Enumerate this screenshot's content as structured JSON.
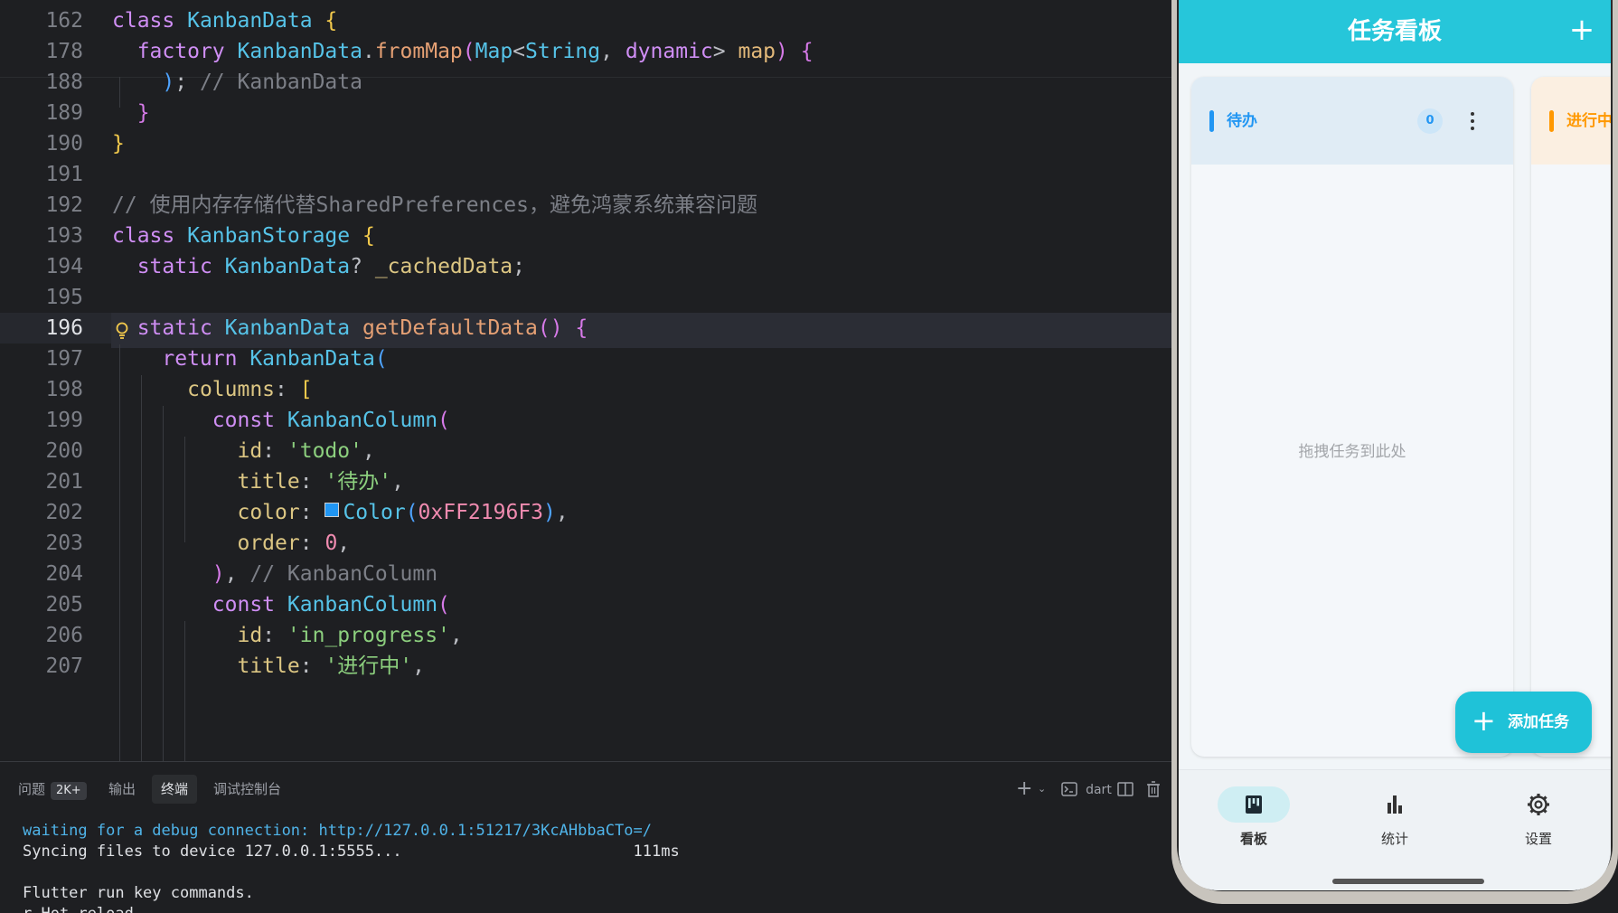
{
  "editor": {
    "lines": [
      {
        "n": "162",
        "tokens": [
          [
            "kw",
            "class "
          ],
          [
            "cls",
            "KanbanData "
          ],
          [
            "br1",
            "{"
          ]
        ]
      },
      {
        "n": "178",
        "tokens": [
          [
            "pl",
            "  "
          ],
          [
            "kw",
            "factory "
          ],
          [
            "cls",
            "KanbanData"
          ],
          [
            "pl",
            "."
          ],
          [
            "fn",
            "fromMap"
          ],
          [
            "br2",
            "("
          ],
          [
            "cls",
            "Map"
          ],
          [
            "pl",
            "<"
          ],
          [
            "cls",
            "String"
          ],
          [
            "pl",
            ", "
          ],
          [
            "kw",
            "dynamic"
          ],
          [
            "pl",
            "> "
          ],
          [
            "prm",
            "map"
          ],
          [
            "br2",
            ") "
          ],
          [
            "br2",
            "{"
          ]
        ]
      },
      {
        "n": "188",
        "tokens": [
          [
            "pl",
            "    "
          ],
          [
            "br3",
            ")"
          ],
          [
            "pl",
            "; "
          ],
          [
            "cmt",
            "// KanbanData"
          ]
        ]
      },
      {
        "n": "189",
        "tokens": [
          [
            "pl",
            "  "
          ],
          [
            "br2",
            "}"
          ]
        ]
      },
      {
        "n": "190",
        "tokens": [
          [
            "br1",
            "}"
          ]
        ]
      },
      {
        "n": "191",
        "tokens": []
      },
      {
        "n": "192",
        "tokens": [
          [
            "cmt",
            "// 使用内存存储代替SharedPreferences，避免鸿蒙系统兼容问题"
          ]
        ]
      },
      {
        "n": "193",
        "tokens": [
          [
            "kw",
            "class "
          ],
          [
            "cls",
            "KanbanStorage "
          ],
          [
            "br1",
            "{"
          ]
        ]
      },
      {
        "n": "194",
        "tokens": [
          [
            "pl",
            "  "
          ],
          [
            "kw",
            "static "
          ],
          [
            "cls",
            "KanbanData"
          ],
          [
            "pl",
            "? "
          ],
          [
            "fld",
            "_cachedData"
          ],
          [
            "pl",
            ";"
          ]
        ]
      },
      {
        "n": "195",
        "tokens": []
      },
      {
        "n": "196",
        "tokens": [
          [
            "pl",
            "  "
          ],
          [
            "kw",
            "static "
          ],
          [
            "cls",
            "KanbanData "
          ],
          [
            "fn",
            "getDefaultData"
          ],
          [
            "br2",
            "() "
          ],
          [
            "br2",
            "{"
          ]
        ]
      },
      {
        "n": "197",
        "tokens": [
          [
            "pl",
            "    "
          ],
          [
            "kw",
            "return "
          ],
          [
            "cls",
            "KanbanData"
          ],
          [
            "br3",
            "("
          ]
        ]
      },
      {
        "n": "198",
        "tokens": [
          [
            "pl",
            "      "
          ],
          [
            "fld",
            "columns"
          ],
          [
            "pl",
            ": "
          ],
          [
            "br1",
            "["
          ]
        ]
      },
      {
        "n": "199",
        "tokens": [
          [
            "pl",
            "        "
          ],
          [
            "kw",
            "const "
          ],
          [
            "cls",
            "KanbanColumn"
          ],
          [
            "br2",
            "("
          ]
        ]
      },
      {
        "n": "200",
        "tokens": [
          [
            "pl",
            "          "
          ],
          [
            "fld",
            "id"
          ],
          [
            "pl",
            ": "
          ],
          [
            "str",
            "'todo'"
          ],
          [
            "pl",
            ","
          ]
        ]
      },
      {
        "n": "201",
        "tokens": [
          [
            "pl",
            "          "
          ],
          [
            "fld",
            "title"
          ],
          [
            "pl",
            ": "
          ],
          [
            "str",
            "'待办'"
          ],
          [
            "pl",
            ","
          ]
        ]
      },
      {
        "n": "202",
        "tokens": [
          [
            "pl",
            "          "
          ],
          [
            "fld",
            "color"
          ],
          [
            "pl",
            ": "
          ],
          [
            "swatch",
            ""
          ],
          [
            "cls",
            "Color"
          ],
          [
            "br3",
            "("
          ],
          [
            "num",
            "0xFF2196F3"
          ],
          [
            "br3",
            ")"
          ],
          [
            "pl",
            ","
          ]
        ]
      },
      {
        "n": "203",
        "tokens": [
          [
            "pl",
            "          "
          ],
          [
            "fld",
            "order"
          ],
          [
            "pl",
            ": "
          ],
          [
            "num",
            "0"
          ],
          [
            "pl",
            ","
          ]
        ]
      },
      {
        "n": "204",
        "tokens": [
          [
            "pl",
            "        "
          ],
          [
            "br2",
            ")"
          ],
          [
            "pl",
            ", "
          ],
          [
            "cmt",
            "// KanbanColumn"
          ]
        ]
      },
      {
        "n": "205",
        "tokens": [
          [
            "pl",
            "        "
          ],
          [
            "kw",
            "const "
          ],
          [
            "cls",
            "KanbanColumn"
          ],
          [
            "br2",
            "("
          ]
        ]
      },
      {
        "n": "206",
        "tokens": [
          [
            "pl",
            "          "
          ],
          [
            "fld",
            "id"
          ],
          [
            "pl",
            ": "
          ],
          [
            "str",
            "'in_progress'"
          ],
          [
            "pl",
            ","
          ]
        ]
      },
      {
        "n": "207",
        "tokens": [
          [
            "pl",
            "          "
          ],
          [
            "fld",
            "title"
          ],
          [
            "pl",
            ": "
          ],
          [
            "str",
            "'进行中'"
          ],
          [
            "pl",
            ","
          ]
        ]
      }
    ],
    "current_line": "196"
  },
  "panel": {
    "tabs": [
      {
        "label": "问题",
        "badge": "2K+"
      },
      {
        "label": "输出"
      },
      {
        "label": "终端",
        "active": true
      },
      {
        "label": "调试控制台"
      }
    ],
    "tools": {
      "add": "+",
      "shell_label": "dart"
    },
    "terminal": {
      "line1": "waiting for a debug connection: http://127.0.0.1:51217/3KcAHbbaCTo=/",
      "line2": "Syncing files to device 127.0.0.1:5555...                         111ms",
      "line3": "Flutter run key commands.",
      "line4": "r Hot reload."
    }
  },
  "app": {
    "title": "任务看板",
    "add_icon": "plus-icon",
    "columns": [
      {
        "title": "待办",
        "count": "0",
        "color": "#2196F3",
        "bg": "#e0ecf5",
        "empty_text": "拖拽任务到此处"
      },
      {
        "title": "进行中",
        "color": "#FF9800",
        "bg": "#fbefe1"
      }
    ],
    "fab_label": "添加任务",
    "nav": [
      {
        "label": "看板",
        "icon": "board-icon",
        "active": true
      },
      {
        "label": "统计",
        "icon": "bar-chart-icon"
      },
      {
        "label": "设置",
        "icon": "gear-icon"
      }
    ],
    "colors": {
      "primary": "#26C6DA",
      "fab": "#1FC2D8"
    }
  }
}
